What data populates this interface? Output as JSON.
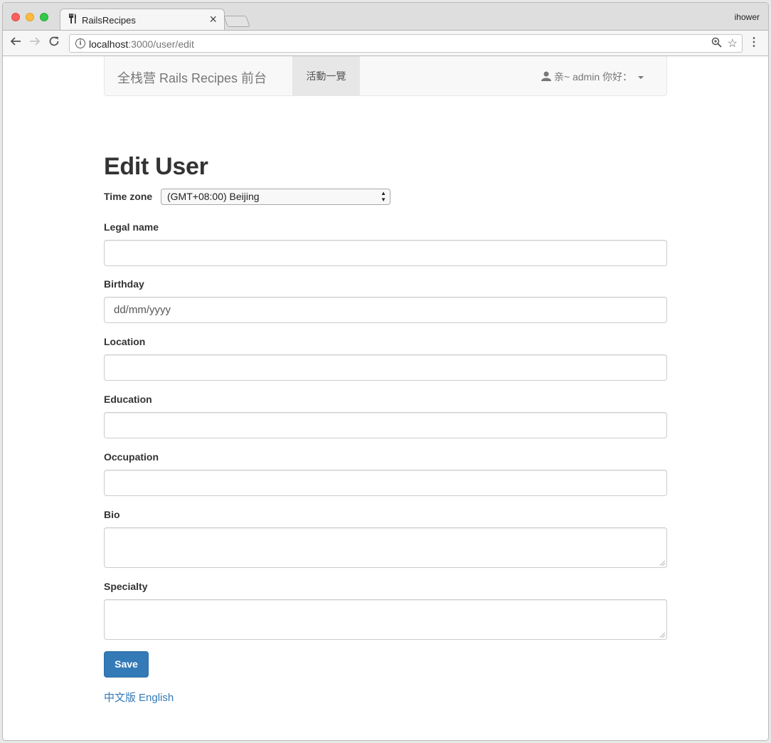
{
  "browser": {
    "tab_title": "RailsRecipes",
    "tab_close": "×",
    "profile_name": "ihower",
    "url_host": "localhost",
    "url_path": ":3000/user/edit"
  },
  "navbar": {
    "brand": "全栈营 Rails Recipes 前台",
    "active_item": "活動一覽",
    "user_greeting": "亲~ admin 你好："
  },
  "form": {
    "title": "Edit User",
    "timezone_label": "Time zone",
    "timezone_value": "(GMT+08:00) Beijing",
    "fields": [
      {
        "label": "Legal name",
        "value": ""
      },
      {
        "label": "Birthday",
        "value": "dd/mm/yyyy"
      },
      {
        "label": "Location",
        "value": ""
      },
      {
        "label": "Education",
        "value": ""
      },
      {
        "label": "Occupation",
        "value": ""
      }
    ],
    "textareas": [
      {
        "label": "Bio",
        "value": ""
      },
      {
        "label": "Specialty",
        "value": ""
      }
    ],
    "save_label": "Save"
  },
  "footer": {
    "lang_chinese": "中文版",
    "lang_english": "English"
  },
  "colors": {
    "primary": "#337ab7",
    "link": "#337ab7"
  },
  "icons": [
    "fork-knife-icon",
    "back-arrow-icon",
    "forward-arrow-icon",
    "reload-icon",
    "info-icon",
    "zoom-icon",
    "star-icon",
    "menu-icon",
    "user-icon",
    "caret-down-icon"
  ]
}
